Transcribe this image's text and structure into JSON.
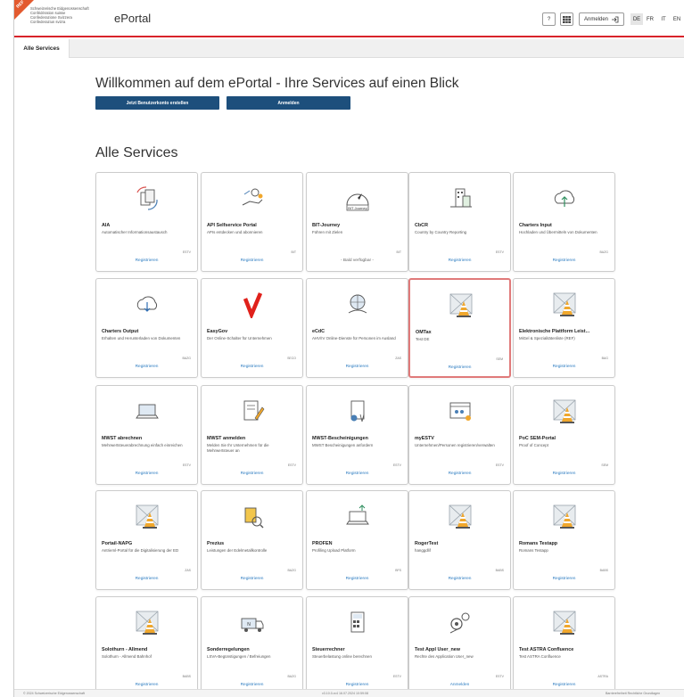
{
  "header": {
    "env_badge": "REF",
    "brand_lines": [
      "Schweizerische Eidgenossenschaft",
      "Confédération suisse",
      "Confederazione Svizzera",
      "Confederaziun svizra"
    ],
    "app_title": "ePortal",
    "help_label": "?",
    "login_label": "Anmelden",
    "languages": [
      "DE",
      "FR",
      "IT",
      "EN"
    ],
    "active_language": "DE"
  },
  "tabs": [
    {
      "label": "Alle Services"
    }
  ],
  "main": {
    "welcome": "Willkommen auf dem ePortal - Ihre Services auf einen Blick",
    "create_account": "Jetzt Benutzerkonto erstellen",
    "login": "Anmelden",
    "section_title": "Alle Services"
  },
  "services": [
    {
      "title": "AIA",
      "desc": "Automatischer Informationsaustausch",
      "org": "ESTV",
      "action": "Registrieren",
      "icon": "docs-icon"
    },
    {
      "title": "API Selfservice Portal",
      "desc": "APIs entdecken und abonnieren",
      "org": "BIT",
      "action": "Registrieren",
      "icon": "hand-api-icon"
    },
    {
      "title": "BIT-Journey",
      "desc": "Führen mit Zielen",
      "org": "BIT",
      "action": "- Bald verfügbar -",
      "icon": "compass-icon"
    },
    {
      "title": "CbCR",
      "desc": "Country by Country Reporting",
      "org": "ESTV",
      "action": "Registrieren",
      "icon": "buildings-icon"
    },
    {
      "title": "Charters Input",
      "desc": "Hochladen und Übermitteln von Dokumenten",
      "org": "BAZG",
      "action": "Registrieren",
      "icon": "cloud-upload-icon"
    },
    {
      "title": "Charters Output",
      "desc": "Erhalten und Herunterladen von Dokumenten",
      "org": "BAZG",
      "action": "Registrieren",
      "icon": "cloud-download-icon"
    },
    {
      "title": "EasyGov",
      "desc": "Der Online-Schalter für Unternehmen",
      "org": "SECO",
      "action": "Registrieren",
      "icon": "checkmark-logo-icon"
    },
    {
      "title": "eCdC",
      "desc": "AHV/IV Online-Dienste für Personen im Ausland",
      "org": "ZAS",
      "action": "Registrieren",
      "icon": "globe-hand-icon"
    },
    {
      "title": "OMTax",
      "desc": "Test DE",
      "org": "SEM",
      "action": "Registrieren",
      "icon": "placeholder-cone-icon"
    },
    {
      "title": "Elektronische Plattform Leist...",
      "desc": "MiGel & Spezialitätenliste (REF)",
      "org": "BAG",
      "action": "Registrieren",
      "icon": "placeholder-cone-icon"
    },
    {
      "title": "MWST abrechnen",
      "desc": "Mehrwertsteuerabrechnung einfach einreichen",
      "org": "ESTV",
      "action": "Registrieren",
      "icon": "laptop-icon"
    },
    {
      "title": "MWST anmelden",
      "desc": "Melden Sie Ihr Unternehmen für die Mehrwertsteuer an",
      "org": "ESTV",
      "action": "Registrieren",
      "icon": "document-pen-icon"
    },
    {
      "title": "MWST-Bescheinigungen",
      "desc": "MWST Bescheinigungen anfordern",
      "org": "ESTV",
      "action": "Registrieren",
      "icon": "certificate-icon"
    },
    {
      "title": "myESTV",
      "desc": "Unternehmen/Personen registrieren/verwalten",
      "org": "ESTV",
      "action": "Registrieren",
      "icon": "browser-people-icon"
    },
    {
      "title": "PoC SEM-Portal",
      "desc": "Proof of Concept",
      "org": "SEM",
      "action": "Registrieren",
      "icon": "placeholder-cone-icon"
    },
    {
      "title": "Portail-NAPG",
      "desc": "Antrieml-Portal für die Digitalisierung der ED",
      "org": "ZAS",
      "action": "Registrieren",
      "icon": "placeholder-cone-icon"
    },
    {
      "title": "Prezius",
      "desc": "Leistungen der Edelmetallkontrolle",
      "org": "BAZG",
      "action": "Registrieren",
      "icon": "gold-scan-icon"
    },
    {
      "title": "PROFEN",
      "desc": "Profiling Upload Platform",
      "org": "BFS",
      "action": "Registrieren",
      "icon": "laptop-upload-icon"
    },
    {
      "title": "RogerTest",
      "desc": "hanggdlif",
      "org": "BABS",
      "action": "Registrieren",
      "icon": "placeholder-cone-icon"
    },
    {
      "title": "Romans Testapp",
      "desc": "Romans Testapp",
      "org": "BABS",
      "action": "Registrieren",
      "icon": "placeholder-cone-icon"
    },
    {
      "title": "Solothurn - Allmend",
      "desc": "Solothurn - Allmend Bahnhof",
      "org": "BABS",
      "action": "Registrieren",
      "icon": "placeholder-cone-icon"
    },
    {
      "title": "Sonderregelungen",
      "desc": "LSVA-Begünstigungen / Befreiungen",
      "org": "BAZG",
      "action": "Registrieren",
      "icon": "truck-icon"
    },
    {
      "title": "Steuerrechner",
      "desc": "Steuerbelastung online berechnen",
      "org": "ESTV",
      "action": "Registrieren",
      "icon": "calculator-icon"
    },
    {
      "title": "Test Appl User_new",
      "desc": "Rechte des Application User_new",
      "org": "ESTV",
      "action": "Anmelden",
      "icon": "gears-icon"
    },
    {
      "title": "Test ASTRA Confluence",
      "desc": "Test ASTRA Confluence",
      "org": "ASTRA",
      "action": "Registrieren",
      "icon": "placeholder-cone-icon"
    }
  ],
  "footer": {
    "copyright": "© 2024 Schweizerische Eidgenossenschaft",
    "version": "v3.10.0-rc4 16.07.2024 10:59:08",
    "links": "Barrierefreiheit  Rechtliche Grundlagen"
  }
}
